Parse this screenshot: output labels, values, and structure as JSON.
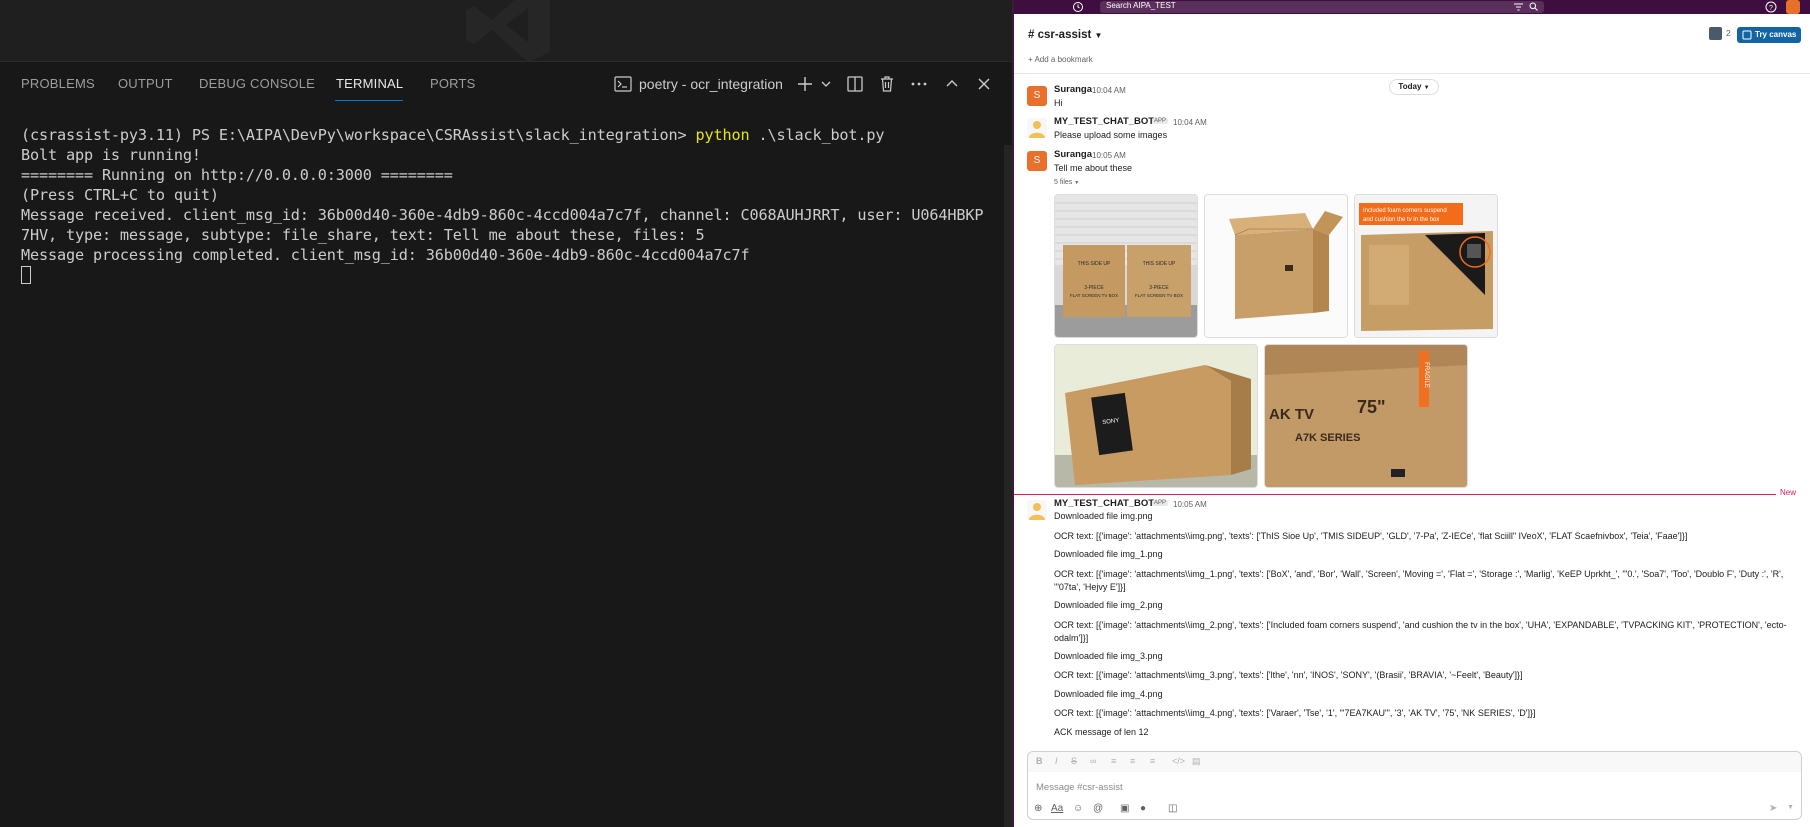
{
  "vscode": {
    "panel_tabs": [
      {
        "label": "PROBLEMS",
        "active": false
      },
      {
        "label": "OUTPUT",
        "active": false
      },
      {
        "label": "DEBUG CONSOLE",
        "active": false
      },
      {
        "label": "TERMINAL",
        "active": true
      },
      {
        "label": "PORTS",
        "active": false
      }
    ],
    "terminal_name": "poetry - ocr_integration",
    "terminal_lines": {
      "prompt": "(csrassist-py3.11) PS E:\\AIPA\\DevPy\\workspace\\CSRAssist\\slack_integration> ",
      "command": "python",
      "command_args": " .\\slack_bot.py",
      "l1": "Bolt app is running!",
      "l2": "======== Running on http://0.0.0.0:3000 ========",
      "l3": "(Press CTRL+C to quit)",
      "l4": "Message received. client_msg_id: 36b00d40-360e-4db9-860c-4ccd004a7c7f, channel: C068AUHJRRT, user: U064HBKP",
      "l5": "7HV, type: message, subtype: file_share, text: Tell me about these, files: 5",
      "l6": "Message processing completed. client_msg_id: 36b00d40-360e-4db9-860c-4ccd004a7c7f"
    },
    "colors": {
      "bg": "#181818",
      "text": "#cccccc",
      "command": "#e5e510",
      "accent": "#0078d4"
    }
  },
  "slack": {
    "search_placeholder": "Search AIPA_TEST",
    "channel_name": "# csr-assist",
    "bookmark_label": "+  Add a bookmark",
    "member_count": "2",
    "try_canvas": "Try canvas",
    "date_divider": "Today",
    "messages": [
      {
        "sender": "Suranga",
        "time": "10:04 AM",
        "text": "Hi",
        "avatar": "S"
      },
      {
        "sender": "MY_TEST_CHAT_BOT",
        "badge": "APP",
        "time": "10:04 AM",
        "text": "Please upload some images"
      },
      {
        "sender": "Suranga",
        "time": "10:05 AM",
        "text": "Tell me about these",
        "avatar": "S",
        "files_label": "5 files"
      }
    ],
    "new_label": "New",
    "bot_reply": {
      "sender": "MY_TEST_CHAT_BOT",
      "badge": "APP",
      "time": "10:05 AM",
      "lines": [
        "Downloaded file img.png",
        "OCR text: [{'image': 'attachments\\\\img.png', 'texts': ['ThIS Sioe Up', 'TMIS SIDEUP', 'GLD', '7-Pa', 'Z-IECe', 'flat Sciill\" IVeoX', 'FLAT Scaefnivbox', 'Teia', 'Faae']}]",
        "Downloaded file img_1.png",
        "OCR text: [{'image': 'attachments\\\\img_1.png', 'texts': ['BoX', 'and', 'Bor', 'Wall', 'Screen', 'Moving =', 'Flat =', 'Storage :', 'Marlig', 'KeEP Uprkht_', '\"0.', 'Soa7', 'Too', 'Doublo F', 'Duty :', 'R', '\"07ta', 'Hejvy E']}]",
        "Downloaded file img_2.png",
        "OCR text: [{'image': 'attachments\\\\img_2.png', 'texts': ['Included foam corners suspend', 'and cushion the tv in the box', 'UHA', 'EXPANDABLE', 'TVPACKING KIT', 'PROTECTION', 'ecto-odalm']}]",
        "Downloaded file img_3.png",
        "OCR text: [{'image': 'attachments\\\\img_3.png', 'texts': ['lthe', 'nn', 'INOS', 'SONY', '(Brasii', 'BRAVIA', '~Feelt', 'Beauty']}]",
        "Downloaded file img_4.png",
        "OCR text: [{'image': 'attachments\\\\img_4.png', 'texts': ['Varaer', 'Tse', '1', '\"7EA7KAU\"', '3', 'AK TV', '75', 'NK SERIES', 'D']}]",
        "ACK message of len 12"
      ]
    },
    "composer_placeholder": "Message #csr-assist",
    "image_captions": {
      "img0": [
        "THIS SIDE UP",
        "3-PIECE",
        "FLAT SCREEN TV BOX"
      ],
      "img2": [
        "Included foam corners suspend",
        "and cushion the tv in the box"
      ],
      "img3": "SONY",
      "img4": [
        "AK TV",
        "75\"",
        "A7K SERIES",
        "FRAGILE"
      ]
    },
    "colors": {
      "aubergine": "#3f0e40",
      "new_line": "#e01e5a",
      "button_blue": "#1264a3",
      "avatar_orange": "#e8702a"
    }
  }
}
